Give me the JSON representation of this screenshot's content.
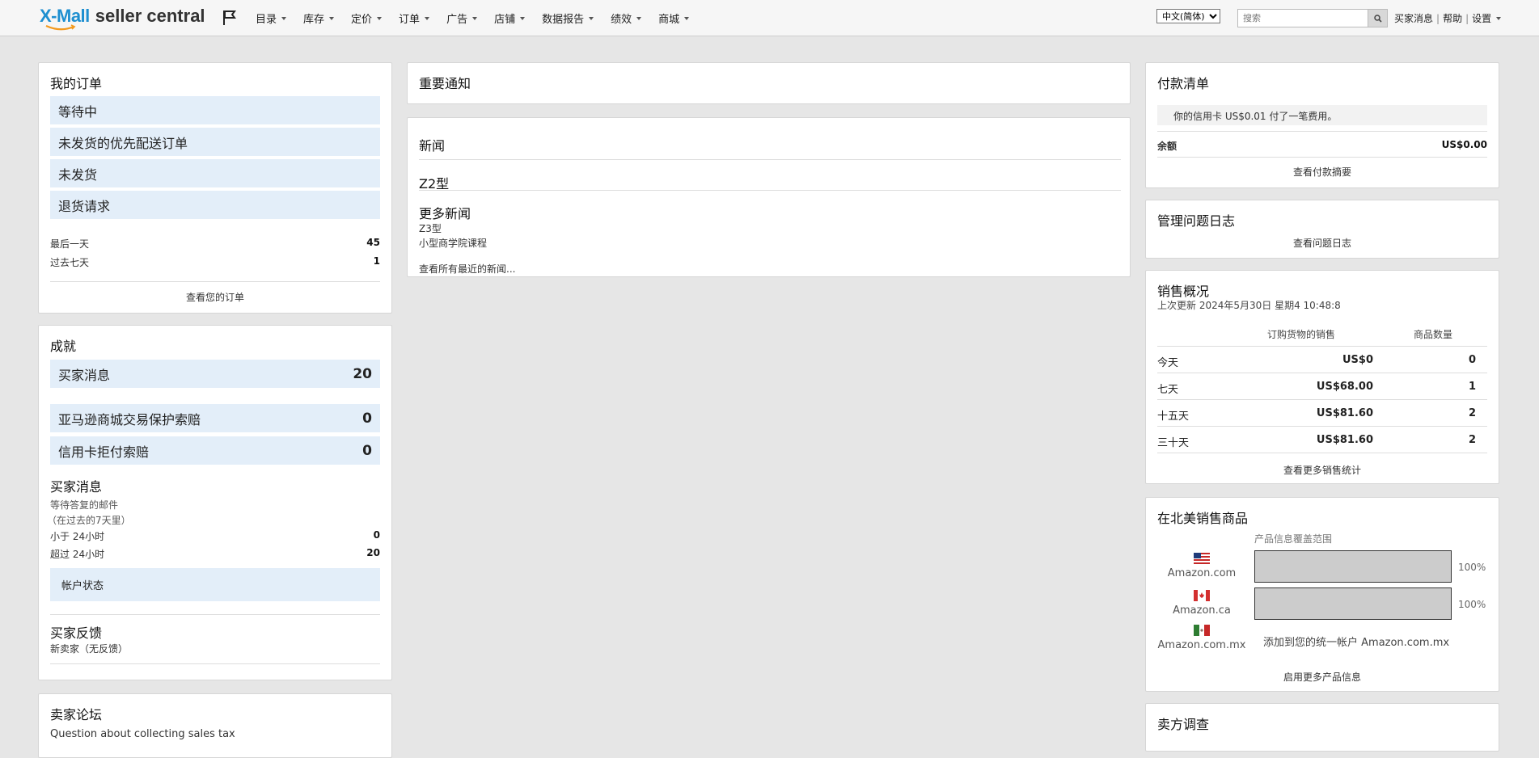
{
  "header": {
    "logo_main": "X-Mall",
    "logo_sub": "seller central",
    "nav": [
      "目录",
      "库存",
      "定价",
      "订单",
      "广告",
      "店铺",
      "数据报告",
      "绩效",
      "商城"
    ],
    "language": "中文(简体)",
    "search_placeholder": "搜索",
    "links": [
      "买家消息",
      "帮助",
      "设置"
    ]
  },
  "orders": {
    "title": "我的订单",
    "items": [
      "等待中",
      "未发货的优先配送订单",
      "未发货",
      "退货请求"
    ],
    "stats": [
      {
        "label": "最后一天",
        "value": "45"
      },
      {
        "label": "过去七天",
        "value": "1"
      }
    ],
    "link": "查看您的订单"
  },
  "achievements": {
    "title": "成就",
    "items": [
      {
        "label": "买家消息",
        "count": "20"
      },
      {
        "label": "亚马逊商城交易保护索赔",
        "count": "0"
      },
      {
        "label": "信用卡拒付索赔",
        "count": "0"
      }
    ],
    "buyer_messages": {
      "title": "买家消息",
      "line1": "等待答复的邮件",
      "line2": "（在过去的7天里）",
      "rows": [
        {
          "label": "小于 24小时",
          "value": "0"
        },
        {
          "label": "超过 24小时",
          "value": "20"
        }
      ]
    },
    "account_status": "帐户状态",
    "feedback": {
      "title": "买家反馈",
      "text": "新卖家（无反馈）"
    }
  },
  "forum": {
    "title": "卖家论坛",
    "item": "Question about collecting sales tax"
  },
  "notice": {
    "title": "重要通知"
  },
  "news": {
    "title": "新闻",
    "headline": "Z2型",
    "more_title": "更多新闻",
    "more_items": [
      "Z3型",
      "小型商学院课程"
    ],
    "link": "查看所有最近的新闻..."
  },
  "payments": {
    "title": "付款清单",
    "notice": "你的信用卡 US$0.01 付了一笔费用。",
    "balance_label": "余额",
    "balance_value": "US$0.00",
    "link": "查看付款摘要"
  },
  "issues": {
    "title": "管理问题日志",
    "link": "查看问题日志"
  },
  "sales": {
    "title": "销售概况",
    "updated": "上次更新 2024年5月30日 星期4 10:48:8",
    "col_sales": "订购货物的销售",
    "col_qty": "商品数量",
    "rows": [
      {
        "period": "今天",
        "sales": "US$0",
        "qty": "0"
      },
      {
        "period": "七天",
        "sales": "US$68.00",
        "qty": "1"
      },
      {
        "period": "十五天",
        "sales": "US$81.60",
        "qty": "2"
      },
      {
        "period": "三十天",
        "sales": "US$81.60",
        "qty": "2"
      }
    ],
    "link": "查看更多销售统计"
  },
  "marketplaces": {
    "title": "在北美销售商品",
    "coverage_label": "产品信息覆盖范围",
    "items": [
      {
        "name": "Amazon.com",
        "pct": "100%",
        "fill": 1.0
      },
      {
        "name": "Amazon.ca",
        "pct": "100%",
        "fill": 1.0
      },
      {
        "name": "Amazon.com.mx",
        "add_text": "添加到您的统一帐户 Amazon.com.mx"
      }
    ],
    "link": "启用更多产品信息"
  },
  "survey": {
    "title": "卖方调查"
  }
}
